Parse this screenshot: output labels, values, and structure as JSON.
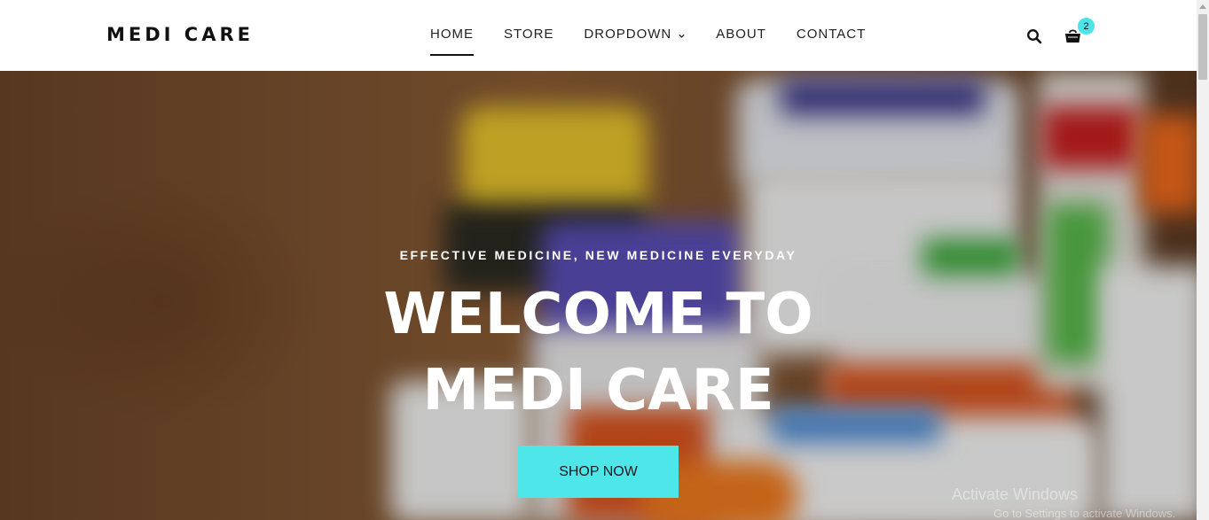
{
  "header": {
    "logo": "MEDI CARE",
    "nav": [
      {
        "label": "HOME",
        "active": true
      },
      {
        "label": "STORE",
        "active": false
      },
      {
        "label": "DROPDOWN",
        "active": false,
        "has_dropdown": true
      },
      {
        "label": "ABOUT",
        "active": false
      },
      {
        "label": "CONTACT",
        "active": false
      }
    ],
    "search_icon": "search-icon",
    "cart_icon": "shopping-bag-icon",
    "cart_count": "2"
  },
  "hero": {
    "subtitle": "EFFECTIVE MEDICINE, NEW MEDICINE EVERYDAY",
    "title_line1": "WELCOME TO",
    "title_line2": "MEDI CARE",
    "button_label": "SHOP NOW"
  },
  "watermark": {
    "line1": "Activate Windows",
    "line2": "Go to Settings to activate Windows."
  },
  "colors": {
    "accent": "#4fe6ea",
    "badge": "#4de3e8",
    "text_dark": "#111111"
  }
}
